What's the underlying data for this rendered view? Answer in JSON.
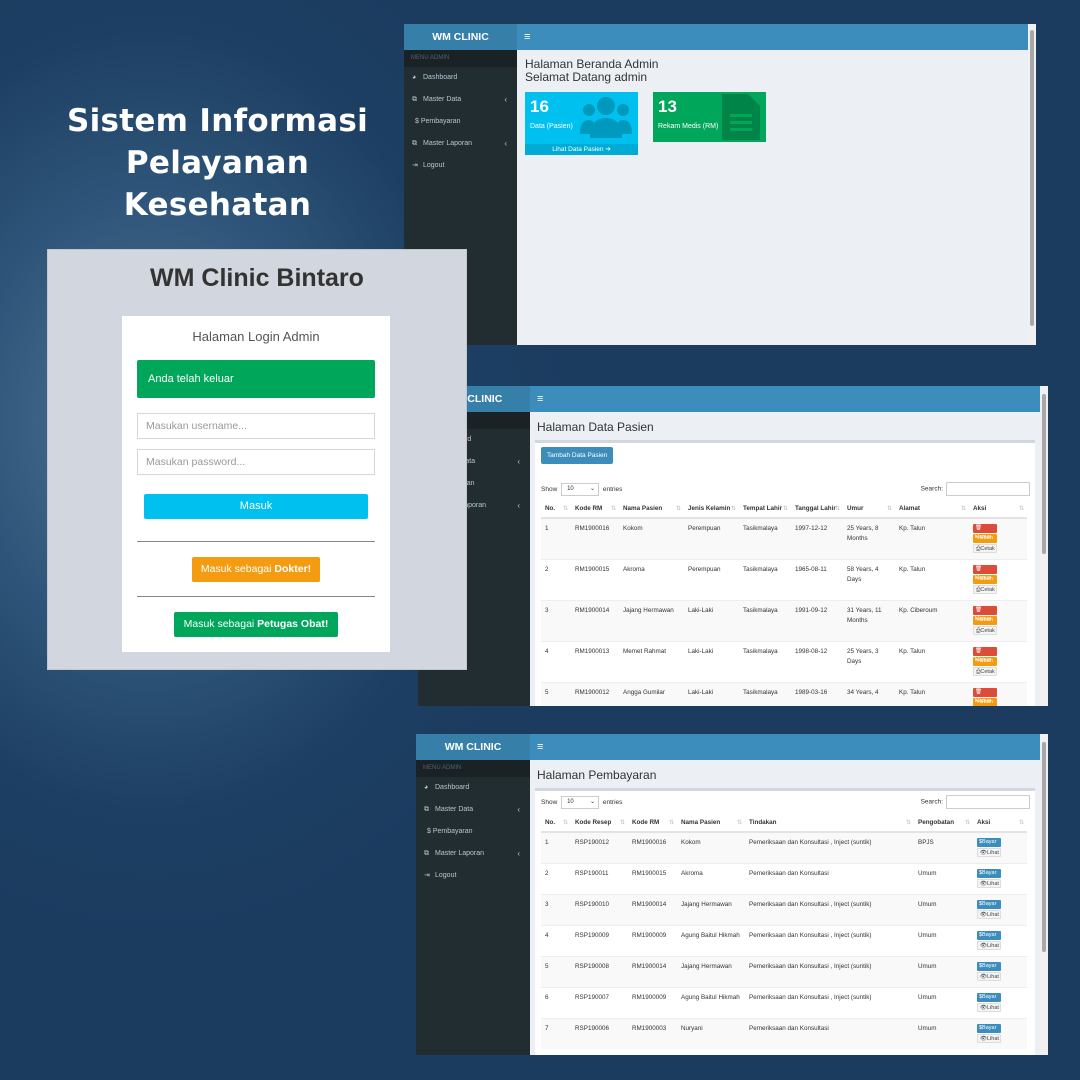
{
  "hero": {
    "line1": "Sistem Informasi",
    "line2": "Pelayanan Kesehatan"
  },
  "sidebar": {
    "brand": "WM CLINIC",
    "header": "MENU ADMIN",
    "items": [
      {
        "label": "Dashboard",
        "icon": "dashboard-icon"
      },
      {
        "label": "Master Data",
        "icon": "files-icon"
      },
      {
        "label": "$ Pembayaran",
        "icon": "dollar-icon"
      },
      {
        "label": "Master Laporan",
        "icon": "files-icon"
      },
      {
        "label": "Logout",
        "icon": "logout-icon"
      }
    ],
    "toggle": "≡"
  },
  "dashboard": {
    "title": "Halaman Beranda Admin",
    "welcome": "Selamat Datang admin",
    "box_pasien": {
      "count": "16",
      "label": "Data (Pasien)",
      "link": "Lihat Data Pasien ➔",
      "color": "#00c0ef"
    },
    "box_rm": {
      "count": "13",
      "label": "Rekam Medis (RM)",
      "color": "#00a65a"
    }
  },
  "login": {
    "logo": "WM Clinic Bintaro",
    "message": "Halaman Login Admin",
    "alert": "Anda telah keluar",
    "username_placeholder": "Masukan username...",
    "password_placeholder": "Masukan password...",
    "submit": "Masuk",
    "doctor_prefix": "Masuk sebagai ",
    "doctor_role": "Dokter!",
    "pharmacy_prefix": "Masuk sebagai ",
    "pharmacy_role": "Petugas Obat!"
  },
  "pasien_page": {
    "title": "Halaman Data Pasien",
    "add_button": "Tambah Data Pasien",
    "show_label": "Show",
    "entries_value": "10",
    "entries_label": "entries",
    "search_label": "Search:",
    "columns": [
      "No.",
      "Kode RM",
      "Nama Pasien",
      "Jenis Kelamin",
      "Tempat Lahir",
      "Tanggal Lahir",
      "Umur",
      "Alamat",
      "Aksi"
    ],
    "actions": {
      "delete": "🗑Hapus",
      "edit": "✎Ubah",
      "print": "⎙Cetak"
    },
    "rows": [
      {
        "no": "1",
        "kode": "RM1900016",
        "nama": "Kokom",
        "jk": "Perempuan",
        "tempat": "Tasikmalaya",
        "tanggal": "1997-12-12",
        "umur": "25 Years, 8 Months",
        "alamat": "Kp. Talun"
      },
      {
        "no": "2",
        "kode": "RM1900015",
        "nama": "Akroma",
        "jk": "Perempuan",
        "tempat": "Tasikmalaya",
        "tanggal": "1965-08-11",
        "umur": "58 Years, 4 Days",
        "alamat": "Kp. Talun"
      },
      {
        "no": "3",
        "kode": "RM1900014",
        "nama": "Jajang Hermawan",
        "jk": "Laki-Laki",
        "tempat": "Tasikmalaya",
        "tanggal": "1991-09-12",
        "umur": "31 Years, 11 Months",
        "alamat": "Kp. Ciberoum"
      },
      {
        "no": "4",
        "kode": "RM1900013",
        "nama": "Memet Rahmat",
        "jk": "Laki-Laki",
        "tempat": "Tasikmalaya",
        "tanggal": "1998-08-12",
        "umur": "25 Years, 3 Days",
        "alamat": "Kp. Talun"
      },
      {
        "no": "5",
        "kode": "RM1900012",
        "nama": "Angga Gumilar",
        "jk": "Laki-Laki",
        "tempat": "Tasikmalaya",
        "tanggal": "1989-03-16",
        "umur": "34 Years, 4",
        "alamat": "Kp. Talun"
      }
    ]
  },
  "pembayaran_page": {
    "title": "Halaman Pembayaran",
    "show_label": "Show",
    "entries_value": "10",
    "entries_label": "entries",
    "search_label": "Search:",
    "columns": [
      "No.",
      "Kode Resep",
      "Kode RM",
      "Nama Pasien",
      "Tindakan",
      "Pengobatan",
      "Aksi"
    ],
    "actions": {
      "pay": "$Bayar",
      "view": "👁Lihat"
    },
    "rows": [
      {
        "no": "1",
        "resep": "RSP190012",
        "rm": "RM1900016",
        "nama": "Kokom",
        "tindakan": "Pemeriksaan dan Konsultasi , Inject (suntik)",
        "pengobatan": "BPJS"
      },
      {
        "no": "2",
        "resep": "RSP190011",
        "rm": "RM1900015",
        "nama": "Akroma",
        "tindakan": "Pemeriksaan dan Konsultasi",
        "pengobatan": "Umum"
      },
      {
        "no": "3",
        "resep": "RSP190010",
        "rm": "RM1900014",
        "nama": "Jajang Hermawan",
        "tindakan": "Pemeriksaan dan Konsultasi , Inject (suntik)",
        "pengobatan": "Umum"
      },
      {
        "no": "4",
        "resep": "RSP190009",
        "rm": "RM1900009",
        "nama": "Agung Baitul Hikmah",
        "tindakan": "Pemeriksaan dan Konsultasi , Inject (suntik)",
        "pengobatan": "Umum"
      },
      {
        "no": "5",
        "resep": "RSP190008",
        "rm": "RM1900014",
        "nama": "Jajang Hermawan",
        "tindakan": "Pemeriksaan dan Konsultasi , Inject (suntik)",
        "pengobatan": "Umum"
      },
      {
        "no": "6",
        "resep": "RSP190007",
        "rm": "RM1900009",
        "nama": "Agung Baitul Hikmah",
        "tindakan": "Pemeriksaan dan Konsultasi , Inject (suntik)",
        "pengobatan": "Umum"
      },
      {
        "no": "7",
        "resep": "RSP190006",
        "rm": "RM1900003",
        "nama": "Nuryani",
        "tindakan": "Pemeriksaan dan Konsultasi",
        "pengobatan": "Umum"
      }
    ]
  }
}
